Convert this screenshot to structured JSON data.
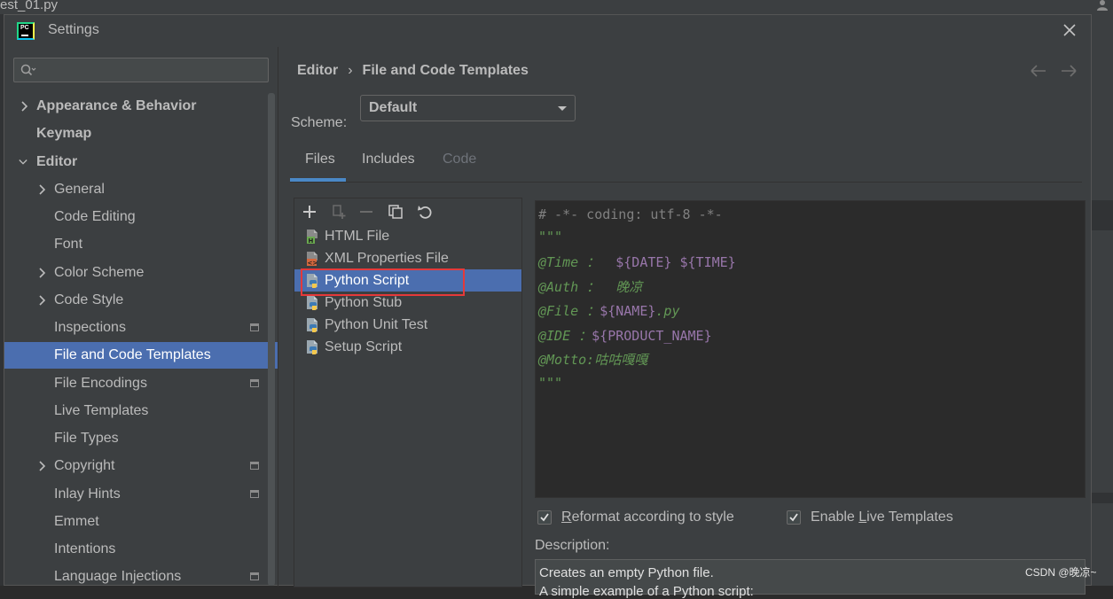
{
  "background": {
    "window_title": "est_01.py"
  },
  "dialog": {
    "title": "Settings",
    "search_placeholder": ""
  },
  "sidebar": {
    "items": [
      {
        "label": "Appearance & Behavior",
        "bold": true,
        "expandable": true,
        "expanded": false
      },
      {
        "label": "Keymap",
        "bold": true
      },
      {
        "label": "Editor",
        "bold": true,
        "expandable": true,
        "expanded": true
      },
      {
        "label": "General",
        "expandable": true
      },
      {
        "label": "Code Editing"
      },
      {
        "label": "Font"
      },
      {
        "label": "Color Scheme",
        "expandable": true
      },
      {
        "label": "Code Style",
        "expandable": true
      },
      {
        "label": "Inspections",
        "project_icon": true
      },
      {
        "label": "File and Code Templates",
        "selected": true
      },
      {
        "label": "File Encodings",
        "project_icon": true
      },
      {
        "label": "Live Templates"
      },
      {
        "label": "File Types"
      },
      {
        "label": "Copyright",
        "expandable": true,
        "project_icon": true
      },
      {
        "label": "Inlay Hints",
        "project_icon": true
      },
      {
        "label": "Emmet"
      },
      {
        "label": "Intentions"
      },
      {
        "label": "Language Injections",
        "project_icon": true
      }
    ]
  },
  "breadcrumb": {
    "parent": "Editor",
    "separator": "›",
    "current": "File and Code Templates"
  },
  "scheme": {
    "label": "Scheme:",
    "value": "Default"
  },
  "tabs": [
    {
      "label": "Files",
      "active": true
    },
    {
      "label": "Includes"
    },
    {
      "label": "Code",
      "disabled": true
    }
  ],
  "templates": {
    "items": [
      {
        "label": "HTML File",
        "icon": "html-file-icon"
      },
      {
        "label": "XML Properties File",
        "icon": "xml-file-icon"
      },
      {
        "label": "Python Script",
        "icon": "python-file-icon",
        "selected": true
      },
      {
        "label": "Python Stub",
        "icon": "python-file-icon"
      },
      {
        "label": "Python Unit Test",
        "icon": "python-file-icon"
      },
      {
        "label": "Setup Script",
        "icon": "python-file-icon"
      }
    ]
  },
  "editor": {
    "line1": "# -*- coding: utf-8 -*-",
    "line2": "\"\"\"",
    "time_key": "@Time ：  ",
    "time_v1": "${DATE}",
    "time_sp": " ",
    "time_v2": "${TIME}",
    "auth_key": "@Auth ：  晚凉",
    "file_key": "@File ：",
    "file_var": "${NAME}",
    "file_ext": ".py",
    "ide_key": "@IDE ：",
    "ide_var": "${PRODUCT_NAME}",
    "motto": "@Motto:咕咕嘎嘎",
    "line8": "\"\"\""
  },
  "options": {
    "reformat_pre": "",
    "reformat_ul": "R",
    "reformat_post": "eformat according to style",
    "reformat_checked": true,
    "live_pre": "Enable ",
    "live_ul": "L",
    "live_post": "ive Templates",
    "live_checked": true
  },
  "description": {
    "label": "Description:",
    "line1": "Creates an empty Python file.",
    "line2": "A simple example of a Python script:"
  },
  "watermark": "CSDN @晚凉~",
  "colors": {
    "selection": "#4b6eaf",
    "accent_tab": "#4a88c7",
    "highlight_box": "#e5393a",
    "template_var": "#9876aa",
    "doc_green": "#629755"
  }
}
